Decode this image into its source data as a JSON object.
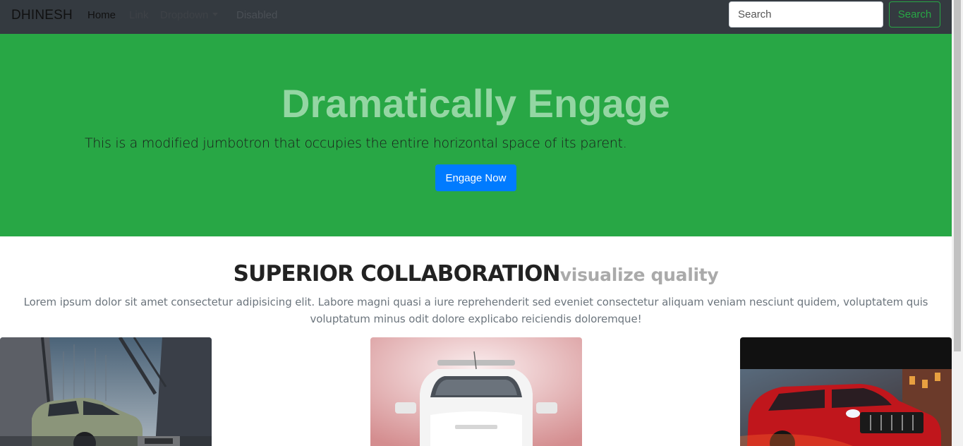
{
  "navbar": {
    "brand": "DHINESH",
    "items": [
      {
        "label": "Home"
      },
      {
        "label": "Link"
      },
      {
        "label": "Dropdown"
      },
      {
        "label": "Disabled"
      }
    ],
    "search": {
      "placeholder": "Search",
      "button_label": "Search"
    }
  },
  "jumbotron": {
    "title": "Dramatically Engage",
    "text": "This is a modified jumbotron that occupies the entire horizontal space of its parent.",
    "button_label": "Engage Now"
  },
  "section": {
    "title": "SUPERIOR COLLABORATION",
    "subtitle": "visualize quality",
    "paragraph": "Lorem ipsum dolor sit amet consectetur adipisicing elit. Labore magni quasi a iure reprehenderit sed eveniet consectetur aliquam veniam nesciunt quidem, voluptatem quis voluptatum minus odit dolore explicabo reiciendis doloremque!"
  },
  "cards": [
    {
      "image": "green-suv-photo"
    },
    {
      "image": "white-suv-photo"
    },
    {
      "image": "red-suv-photo"
    }
  ],
  "colors": {
    "navbar_bg": "#343a40",
    "jumbotron_bg": "#28a745",
    "primary": "#007bff",
    "success": "#28a745"
  }
}
